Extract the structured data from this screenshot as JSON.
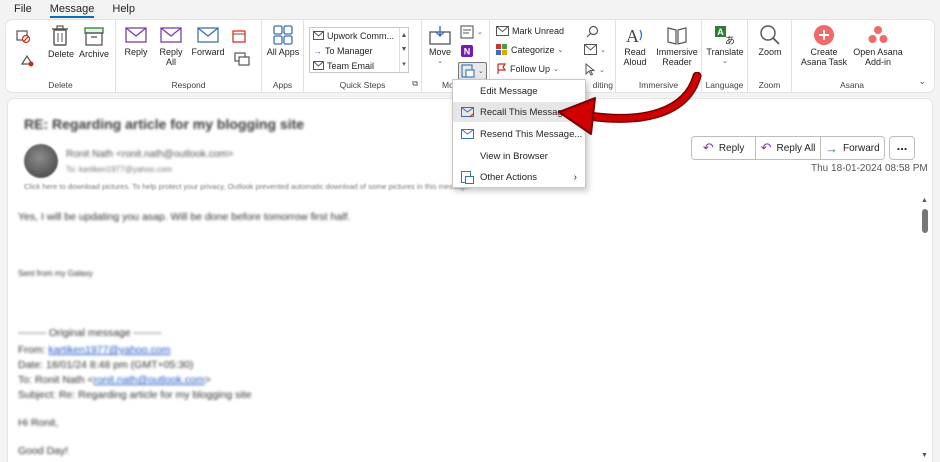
{
  "tabs": [
    "File",
    "Message",
    "Help"
  ],
  "groups": {
    "delete": {
      "label": "Delete",
      "delete_btn": "Delete",
      "archive_btn": "Archive"
    },
    "respond": {
      "label": "Respond",
      "reply": "Reply",
      "reply_all": "Reply All",
      "forward": "Forward"
    },
    "apps": {
      "label": "Apps",
      "all_apps": "All Apps"
    },
    "quick_steps": {
      "label": "Quick Steps",
      "items": [
        "Upwork Comm...",
        "To Manager",
        "Team Email"
      ]
    },
    "move": {
      "label": "Mo",
      "move_btn": "Move"
    },
    "tags": {
      "mark_unread": "Mark Unread",
      "categorize": "Categorize",
      "follow_up": "Follow Up"
    },
    "editing": {
      "label": "diting"
    },
    "immersive": {
      "label": "Immersive",
      "read_aloud": "Read Aloud",
      "immersive_reader": "Immersive Reader"
    },
    "language": {
      "label": "Language",
      "translate": "Translate"
    },
    "zoom": {
      "label": "Zoom",
      "zoom_btn": "Zoom"
    },
    "asana": {
      "label": "Asana",
      "create_task": "Create Asana Task",
      "open_addin": "Open Asana Add-in"
    }
  },
  "email": {
    "subject": "RE: Regarding article for my blogging site",
    "sender": "Ronit Nath <ronit.nath@outlook.com>",
    "to": "To: kartiken1977@yahoo.com",
    "notice": "Click here to download pictures. To help protect your privacy, Outlook prevented automatic download of some pictures in this message.",
    "actions": {
      "reply": "Reply",
      "reply_all": "Reply All",
      "forward": "Forward",
      "more": "..."
    },
    "date": "Thu 18-01-2024 08:58 PM",
    "body_line1": "Yes, I will be updating you asap. Will be done before tomorrow first half.",
    "signature": "Sent from my Galaxy",
    "original_header": "-------- Original message --------",
    "from_label": "From: ",
    "from_value": "kartiken1977@yahoo.com",
    "date_line": "Date: 18/01/24 8:48 pm (GMT+05:30)",
    "to_label": "To: Ronit Nath <",
    "to_value": "ronit.nath@outlook.com",
    "to_end": ">",
    "subject_line": "Subject: Re: Regarding article for my blogging site",
    "greeting1": "Hi Ronit,",
    "greeting2": "Good Day!"
  },
  "menu": {
    "items": [
      "Edit Message",
      "Recall This Message...",
      "Resend This Message...",
      "View in Browser",
      "Other Actions"
    ]
  },
  "colors": {
    "accent": "#0f6cbd",
    "arrow": "#d00000",
    "asana": "#f06a6a"
  }
}
